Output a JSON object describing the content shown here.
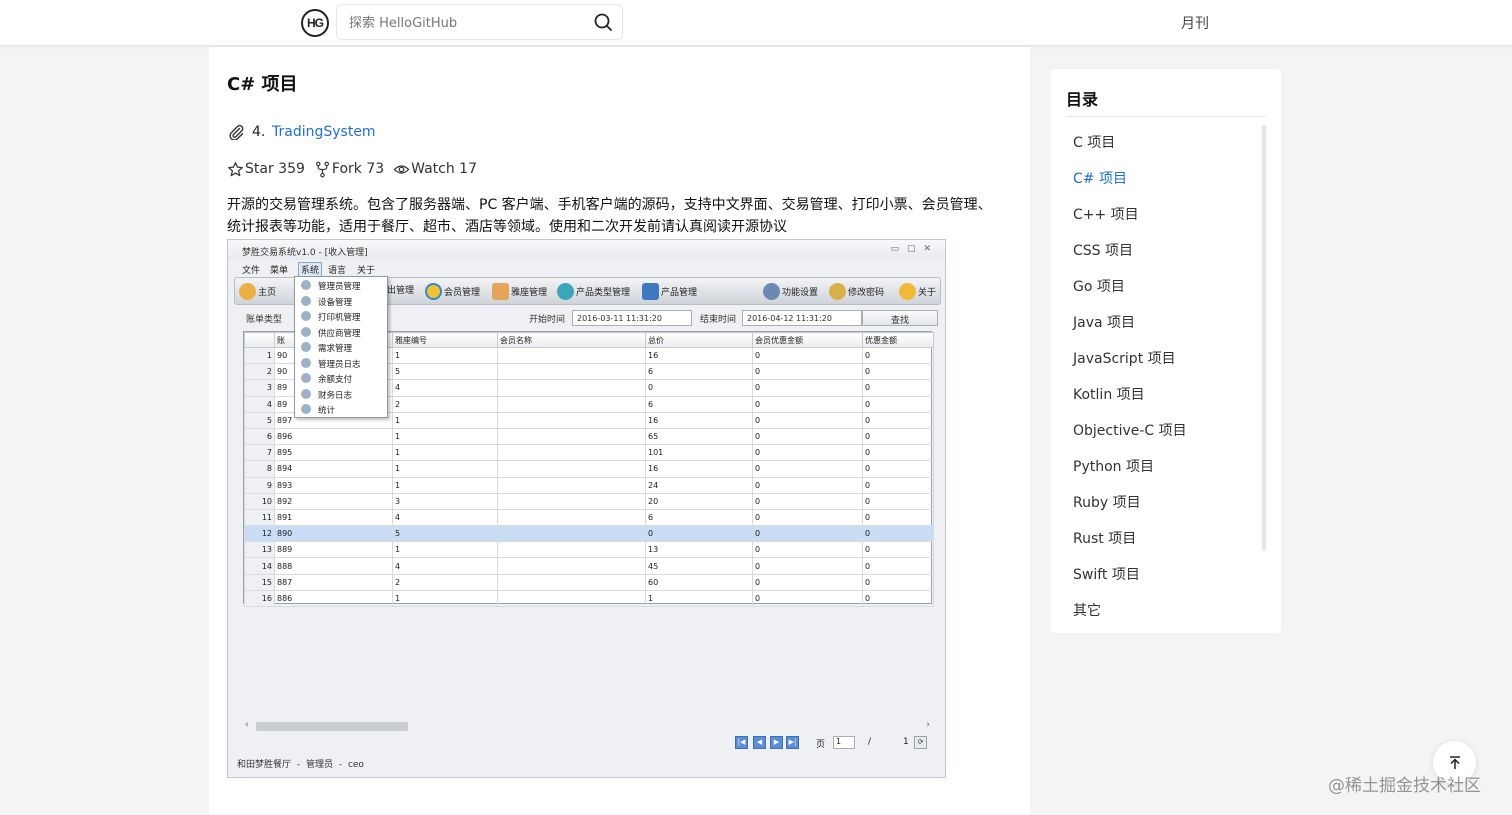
{
  "header": {
    "logo_text": "HG",
    "search_placeholder": "探索 HelloGitHub",
    "monthly_label": "月刊"
  },
  "section": {
    "title": "C# 项目"
  },
  "project": {
    "number": "4.",
    "name": "TradingSystem",
    "star": "Star 359",
    "fork": "Fork 73",
    "watch": "Watch 17",
    "description": "开源的交易管理系统。包含了服务器端、PC 客户端、手机客户端的源码，支持中文界面、交易管理、打印小票、会员管理、统计报表等功能，适用于餐厅、超市、酒店等领域。使用和二次开发前请认真阅读开源协议"
  },
  "screenshot": {
    "window_title": "梦胜交易系统v1.0 - [收入管理]",
    "menu": [
      "文件",
      "菜单",
      "系统",
      "语言",
      "关于"
    ],
    "toolbar": [
      "主页",
      "出管理",
      "会员管理",
      "雅座管理",
      "产品类型管理",
      "产品管理",
      "功能设置",
      "修改密码",
      "关于"
    ],
    "context_menu": [
      "管理员管理",
      "设备管理",
      "打印机管理",
      "供应商管理",
      "需求管理",
      "管理员日志",
      "余额支付",
      "财务日志",
      "统计"
    ],
    "filter": {
      "type_label": "账单类型",
      "start_label": "开始时间",
      "start_value": "2016-03-11 11:31:20",
      "end_label": "结束时间",
      "end_value": "2016-04-12 11:31:20",
      "find_label": "查找"
    },
    "columns": [
      "",
      "账",
      "雅座编号",
      "会员名称",
      "总价",
      "会员优惠金额",
      "优惠金额"
    ],
    "rows": [
      [
        "1",
        "90",
        "1",
        "",
        "16",
        "0",
        "0"
      ],
      [
        "2",
        "90",
        "5",
        "",
        "6",
        "0",
        "0"
      ],
      [
        "3",
        "89",
        "4",
        "",
        "0",
        "0",
        "0"
      ],
      [
        "4",
        "89",
        "2",
        "",
        "6",
        "0",
        "0"
      ],
      [
        "5",
        "897",
        "1",
        "",
        "16",
        "0",
        "0"
      ],
      [
        "6",
        "896",
        "1",
        "",
        "65",
        "0",
        "0"
      ],
      [
        "7",
        "895",
        "1",
        "",
        "101",
        "0",
        "0"
      ],
      [
        "8",
        "894",
        "1",
        "",
        "16",
        "0",
        "0"
      ],
      [
        "9",
        "893",
        "1",
        "",
        "24",
        "0",
        "0"
      ],
      [
        "10",
        "892",
        "3",
        "",
        "20",
        "0",
        "0"
      ],
      [
        "11",
        "891",
        "4",
        "",
        "6",
        "0",
        "0"
      ],
      [
        "12",
        "890",
        "5",
        "",
        "0",
        "0",
        "0"
      ],
      [
        "13",
        "889",
        "1",
        "",
        "13",
        "0",
        "0"
      ],
      [
        "14",
        "888",
        "4",
        "",
        "45",
        "0",
        "0"
      ],
      [
        "15",
        "887",
        "2",
        "",
        "60",
        "0",
        "0"
      ],
      [
        "16",
        "886",
        "1",
        "",
        "1",
        "0",
        "0"
      ]
    ],
    "selected_row": 12,
    "pager": {
      "page_label": "页",
      "page_value": "1",
      "separator": "/",
      "total": "1"
    },
    "status_bar": "和田梦胜餐厅 - 管理员 - ceo"
  },
  "toc": {
    "title": "目录",
    "items": [
      "C 项目",
      "C# 项目",
      "C++ 项目",
      "CSS 项目",
      "Go 项目",
      "Java 项目",
      "JavaScript 项目",
      "Kotlin 项目",
      "Objective-C 项目",
      "Python 项目",
      "Ruby 项目",
      "Rust 项目",
      "Swift 项目",
      "其它"
    ],
    "active_index": 1
  },
  "watermark": "@稀土掘金技术社区",
  "colors": {
    "link": "#1f6fd6",
    "page_bg": "#f4f4f5",
    "selected_row": "#c8dcf3"
  }
}
